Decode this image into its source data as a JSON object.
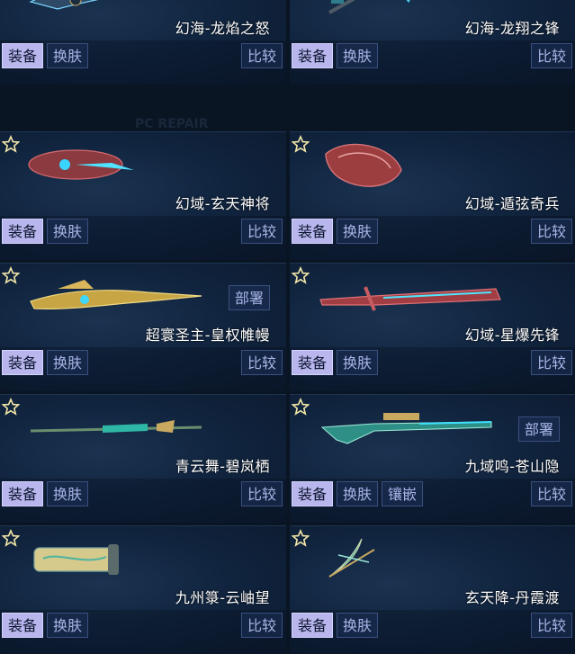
{
  "colors": {
    "background": "#0a1524",
    "equip_button_bg": "#b8b6ec",
    "ghost_button_text": "#a7b5e6",
    "star": "#f2e6a8"
  },
  "watermark": "PC REPAIR",
  "buttons": {
    "equip": "装备",
    "skin": "换肤",
    "compare": "比较",
    "deploy": "部署",
    "inlay": "镶嵌"
  },
  "items": [
    {
      "name": "幻海-龙焰之怒",
      "icon": "dragon-cannon-icon",
      "deploy": false,
      "inlay": false
    },
    {
      "name": "幻海-龙翔之锋",
      "icon": "axe-icon",
      "deploy": false,
      "inlay": false
    },
    {
      "name": "幻域-玄天神将",
      "icon": "red-blaster-icon",
      "deploy": false,
      "inlay": false
    },
    {
      "name": "幻域-遁弦奇兵",
      "icon": "red-shield-icon",
      "deploy": false,
      "inlay": false
    },
    {
      "name": "超寰圣主-皇权帷幔",
      "icon": "golden-rifle-icon",
      "deploy": true,
      "inlay": false
    },
    {
      "name": "幻域-星爆先锋",
      "icon": "red-sword-icon",
      "deploy": false,
      "inlay": false
    },
    {
      "name": "青云舞-碧岚栖",
      "icon": "jade-spear-icon",
      "deploy": false,
      "inlay": false
    },
    {
      "name": "九域鸣-苍山隐",
      "icon": "jade-sniper-icon",
      "deploy": true,
      "inlay": true
    },
    {
      "name": "九州箓-云岫望",
      "icon": "scroll-icon",
      "deploy": false,
      "inlay": false
    },
    {
      "name": "玄天降-丹霞渡",
      "icon": "jade-bow-icon",
      "deploy": false,
      "inlay": false
    }
  ]
}
